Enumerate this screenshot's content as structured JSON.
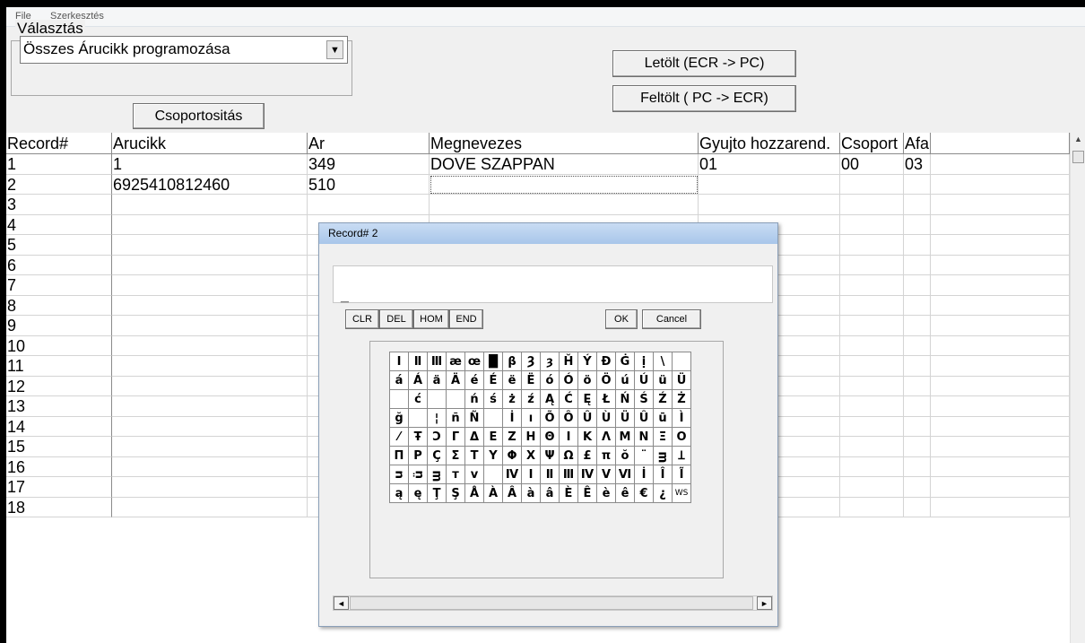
{
  "menu": {
    "file": "File",
    "edit": "Szerkesztés"
  },
  "group": {
    "legend": "Választás",
    "select_value": "Összes Árucikk programozása",
    "select_arrow": "▼"
  },
  "buttons": {
    "group_by": "Csoportositás",
    "download": "Letölt  (ECR -> PC)",
    "upload": "Feltölt ( PC -> ECR)"
  },
  "table": {
    "columns": [
      "Record#",
      "Arucikk",
      "Ar",
      "Megnevezes",
      "Gyujto hozzarend.",
      "Csoport",
      "Afa"
    ],
    "rows": [
      [
        "1",
        "1",
        "349",
        "DOVE SZAPPAN",
        "01",
        "00",
        "03"
      ],
      [
        "2",
        "6925410812460",
        "510",
        "",
        "",
        "",
        ""
      ],
      [
        "3",
        "",
        "",
        "",
        "",
        "",
        ""
      ],
      [
        "4",
        "",
        "",
        "",
        "",
        "",
        ""
      ],
      [
        "5",
        "",
        "",
        "",
        "",
        "",
        ""
      ],
      [
        "6",
        "",
        "",
        "",
        "",
        "",
        ""
      ],
      [
        "7",
        "",
        "",
        "",
        "",
        "",
        ""
      ],
      [
        "8",
        "",
        "",
        "",
        "",
        "",
        ""
      ],
      [
        "9",
        "",
        "",
        "",
        "",
        "",
        ""
      ],
      [
        "10",
        "",
        "",
        "",
        "",
        "",
        ""
      ],
      [
        "11",
        "",
        "",
        "",
        "",
        "",
        ""
      ],
      [
        "12",
        "",
        "",
        "",
        "",
        "",
        ""
      ],
      [
        "13",
        "",
        "",
        "",
        "",
        "",
        ""
      ],
      [
        "14",
        "",
        "",
        "",
        "",
        "",
        ""
      ],
      [
        "15",
        "",
        "",
        "",
        "",
        "",
        ""
      ],
      [
        "16",
        "",
        "",
        "",
        "",
        "",
        ""
      ],
      [
        "17",
        "",
        "",
        "",
        "",
        "",
        ""
      ],
      [
        "18",
        "",
        "",
        "",
        "",
        "",
        ""
      ]
    ]
  },
  "dialog": {
    "title": "Record# 2",
    "input_value": "_",
    "edit_buttons": [
      "CLR",
      "DEL",
      "HOM",
      "END"
    ],
    "ok": "OK",
    "cancel": "Cancel",
    "char_rows": [
      [
        "Ⅰ",
        "Ⅱ",
        "Ⅲ",
        "æ",
        "œ",
        "█",
        "β",
        "Ȝ",
        "ȝ",
        "Ȟ",
        "Ý",
        "Ð",
        "Ġ",
        "ị",
        "\\",
        ""
      ],
      [
        "á",
        "Á",
        "ä",
        "Ä",
        "é",
        "É",
        "ë",
        "Ë",
        "ó",
        "Ó",
        "ö",
        "Ö",
        "ú",
        "Ú",
        "ü",
        "Ü"
      ],
      [
        "",
        "ć",
        "",
        "",
        "ń",
        "ś",
        "ż",
        "ź",
        "Ą",
        "Ć",
        "Ę",
        "Ł",
        "Ń",
        "Ś",
        "Ź",
        "Ż"
      ],
      [
        "ğ",
        "",
        "¦",
        "ñ",
        "Ñ",
        "",
        "İ",
        "ı",
        "Õ",
        "Ô",
        "Û",
        "Ù",
        "Ü",
        "Û",
        "ū",
        "Ì",
        "ì"
      ],
      [
        "⁄",
        "Ŧ",
        "Ͻ",
        "Γ",
        "Δ",
        "E",
        "Z",
        "H",
        "Θ",
        "I",
        "K",
        "Λ",
        "M",
        "N",
        "Ξ",
        "O"
      ],
      [
        "Π",
        "P",
        "Ç",
        "Σ",
        "T",
        "Y",
        "Φ",
        "X",
        "Ψ",
        "Ω",
        "£",
        "π",
        "ŏ",
        "¨",
        "ᴟ",
        "Ʇ"
      ],
      [
        "ᴝ",
        "ᴞ",
        "ᴟ",
        "ᴛ",
        "ᴠ",
        "",
        "Ⅳ",
        "Ⅰ",
        "Ⅱ",
        "Ⅲ",
        "Ⅳ",
        "Ⅴ",
        "Ⅵ",
        "İ",
        "Î",
        "Ĩ"
      ],
      [
        "ą",
        "ę",
        "Ţ",
        "Ş",
        "Å",
        "À",
        "Â",
        "à",
        "â",
        "È",
        "Ê",
        "è",
        "ê",
        "€",
        "¿",
        "WS"
      ]
    ]
  },
  "scroll": {
    "up": "▲",
    "left": "◄",
    "right": "►"
  }
}
